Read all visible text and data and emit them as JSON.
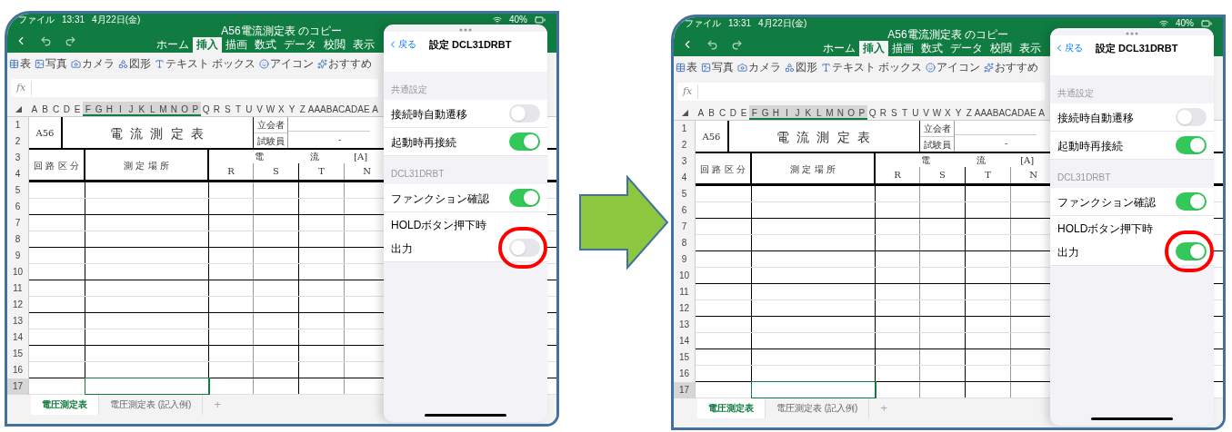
{
  "screens": [
    {
      "status_bar": {
        "app": "ファイル",
        "time": "13:31",
        "date": "4月22日(金)",
        "battery": "40%"
      },
      "document_title": "A56電流測定表 のコピー",
      "ribbon_tabs": [
        {
          "label": "ホーム",
          "selected": false
        },
        {
          "label": "挿入",
          "selected": true
        },
        {
          "label": "描画",
          "selected": false
        },
        {
          "label": "数式",
          "selected": false
        },
        {
          "label": "データ",
          "selected": false
        },
        {
          "label": "校閲",
          "selected": false
        },
        {
          "label": "表示",
          "selected": false
        }
      ],
      "toolbar": [
        "表",
        "写真",
        "カメラ",
        "図形",
        "テキスト ボックス",
        "アイコン",
        "おすすめ"
      ],
      "formula_label": "fx",
      "column_headers": [
        {
          "label": "A",
          "selected": false
        },
        {
          "label": "B",
          "selected": false
        },
        {
          "label": "C",
          "selected": false
        },
        {
          "label": "D",
          "selected": false
        },
        {
          "label": "E",
          "selected": false
        },
        {
          "label": "F",
          "selected": true
        },
        {
          "label": "G",
          "selected": true
        },
        {
          "label": "H",
          "selected": true
        },
        {
          "label": "I",
          "selected": true
        },
        {
          "label": "J",
          "selected": true
        },
        {
          "label": "K",
          "selected": true
        },
        {
          "label": "L",
          "selected": true
        },
        {
          "label": "M",
          "selected": true
        },
        {
          "label": "N",
          "selected": true
        },
        {
          "label": "O",
          "selected": true
        },
        {
          "label": "P",
          "selected": true
        },
        {
          "label": "Q",
          "selected": false
        },
        {
          "label": "R",
          "selected": false
        },
        {
          "label": "S",
          "selected": false
        },
        {
          "label": "T",
          "selected": false
        },
        {
          "label": "U",
          "selected": false
        },
        {
          "label": "V",
          "selected": false
        },
        {
          "label": "W",
          "selected": false
        },
        {
          "label": "X",
          "selected": false
        },
        {
          "label": "Y",
          "selected": false
        },
        {
          "label": "Z",
          "selected": false
        },
        {
          "label": "AA",
          "selected": false
        },
        {
          "label": "AB",
          "selected": false
        },
        {
          "label": "AC",
          "selected": false
        },
        {
          "label": "AD",
          "selected": false
        },
        {
          "label": "AE",
          "selected": false
        },
        {
          "label": "A",
          "selected": false
        }
      ],
      "row_numbers": [
        {
          "label": "1",
          "selected": false
        },
        {
          "label": "2",
          "selected": false
        },
        {
          "label": "3",
          "selected": false
        },
        {
          "label": "4",
          "selected": false
        },
        {
          "label": "5",
          "selected": false
        },
        {
          "label": "6",
          "selected": false
        },
        {
          "label": "7",
          "selected": false
        },
        {
          "label": "8",
          "selected": false
        },
        {
          "label": "9",
          "selected": false
        },
        {
          "label": "10",
          "selected": false
        },
        {
          "label": "11",
          "selected": false
        },
        {
          "label": "12",
          "selected": false
        },
        {
          "label": "13",
          "selected": false
        },
        {
          "label": "14",
          "selected": false
        },
        {
          "label": "15",
          "selected": false
        },
        {
          "label": "16",
          "selected": false
        },
        {
          "label": "17",
          "selected": true
        }
      ],
      "sheet": {
        "id_cell": "A56",
        "title": "電 流 測 定 表",
        "witness_label": "立会者",
        "tester_label": "試験員",
        "tester_value": "-",
        "circuit_header": "回 路 区 分",
        "location_header": "測 定 場 所",
        "current_header": "電 流",
        "unit": "[A]",
        "phases": [
          "R",
          "S",
          "T",
          "N"
        ]
      },
      "sheet_tabs": [
        {
          "label": "電圧測定表",
          "selected": true
        },
        {
          "label": "電圧測定表 (記入例)",
          "selected": false
        }
      ],
      "add_sheet": "+",
      "settings": {
        "back": "戻る",
        "title": "設定 DCL31DRBT",
        "groups": [
          {
            "header": "共通設定",
            "items": [
              {
                "label": "接続時自動遷移",
                "on": false,
                "highlighted": false
              },
              {
                "label": "起動時再接続",
                "on": true,
                "highlighted": false
              }
            ]
          },
          {
            "header": "DCL31DRBT",
            "items": [
              {
                "label": "ファンクション確認",
                "on": true,
                "highlighted": false
              },
              {
                "label": "HOLDボタン押下時",
                "sublabel": "出力",
                "on": false,
                "highlighted": true
              }
            ]
          }
        ]
      }
    },
    {
      "status_bar": {
        "app": "ファイル",
        "time": "13:31",
        "date": "4月22日(金)",
        "battery": "40%"
      },
      "document_title": "A56電流測定表 のコピー",
      "ribbon_tabs": [
        {
          "label": "ホーム",
          "selected": false
        },
        {
          "label": "挿入",
          "selected": true
        },
        {
          "label": "描画",
          "selected": false
        },
        {
          "label": "数式",
          "selected": false
        },
        {
          "label": "データ",
          "selected": false
        },
        {
          "label": "校閲",
          "selected": false
        },
        {
          "label": "表示",
          "selected": false
        }
      ],
      "toolbar": [
        "表",
        "写真",
        "カメラ",
        "図形",
        "テキスト ボックス",
        "アイコン",
        "おすすめ"
      ],
      "formula_label": "fx",
      "column_headers": [
        {
          "label": "A",
          "selected": false
        },
        {
          "label": "B",
          "selected": false
        },
        {
          "label": "C",
          "selected": false
        },
        {
          "label": "D",
          "selected": false
        },
        {
          "label": "E",
          "selected": false
        },
        {
          "label": "F",
          "selected": true
        },
        {
          "label": "G",
          "selected": true
        },
        {
          "label": "H",
          "selected": true
        },
        {
          "label": "I",
          "selected": true
        },
        {
          "label": "J",
          "selected": true
        },
        {
          "label": "K",
          "selected": true
        },
        {
          "label": "L",
          "selected": true
        },
        {
          "label": "M",
          "selected": true
        },
        {
          "label": "N",
          "selected": true
        },
        {
          "label": "O",
          "selected": true
        },
        {
          "label": "P",
          "selected": true
        },
        {
          "label": "Q",
          "selected": false
        },
        {
          "label": "R",
          "selected": false
        },
        {
          "label": "S",
          "selected": false
        },
        {
          "label": "T",
          "selected": false
        },
        {
          "label": "U",
          "selected": false
        },
        {
          "label": "V",
          "selected": false
        },
        {
          "label": "W",
          "selected": false
        },
        {
          "label": "X",
          "selected": false
        },
        {
          "label": "Y",
          "selected": false
        },
        {
          "label": "Z",
          "selected": false
        },
        {
          "label": "AA",
          "selected": false
        },
        {
          "label": "AB",
          "selected": false
        },
        {
          "label": "AC",
          "selected": false
        },
        {
          "label": "AD",
          "selected": false
        },
        {
          "label": "AE",
          "selected": false
        },
        {
          "label": "A",
          "selected": false
        }
      ],
      "row_numbers": [
        {
          "label": "1",
          "selected": false
        },
        {
          "label": "2",
          "selected": false
        },
        {
          "label": "3",
          "selected": false
        },
        {
          "label": "4",
          "selected": false
        },
        {
          "label": "5",
          "selected": false
        },
        {
          "label": "6",
          "selected": false
        },
        {
          "label": "7",
          "selected": false
        },
        {
          "label": "8",
          "selected": false
        },
        {
          "label": "9",
          "selected": false
        },
        {
          "label": "10",
          "selected": false
        },
        {
          "label": "11",
          "selected": false
        },
        {
          "label": "12",
          "selected": false
        },
        {
          "label": "13",
          "selected": false
        },
        {
          "label": "14",
          "selected": false
        },
        {
          "label": "15",
          "selected": false
        },
        {
          "label": "16",
          "selected": false
        },
        {
          "label": "17",
          "selected": true
        }
      ],
      "sheet": {
        "id_cell": "A56",
        "title": "電 流 測 定 表",
        "witness_label": "立会者",
        "tester_label": "試験員",
        "tester_value": "-",
        "circuit_header": "回 路 区 分",
        "location_header": "測 定 場 所",
        "current_header": "電 流",
        "unit": "[A]",
        "phases": [
          "R",
          "S",
          "T",
          "N"
        ]
      },
      "sheet_tabs": [
        {
          "label": "電圧測定表",
          "selected": true
        },
        {
          "label": "電圧測定表 (記入例)",
          "selected": false
        }
      ],
      "add_sheet": "+",
      "settings": {
        "back": "戻る",
        "title": "設定 DCL31DRBT",
        "groups": [
          {
            "header": "共通設定",
            "items": [
              {
                "label": "接続時自動遷移",
                "on": false,
                "highlighted": false
              },
              {
                "label": "起動時再接続",
                "on": true,
                "highlighted": false
              }
            ]
          },
          {
            "header": "DCL31DRBT",
            "items": [
              {
                "label": "ファンクション確認",
                "on": true,
                "highlighted": false
              },
              {
                "label": "HOLDボタン押下時",
                "sublabel": "出力",
                "on": true,
                "highlighted": true
              }
            ]
          }
        ]
      }
    }
  ]
}
